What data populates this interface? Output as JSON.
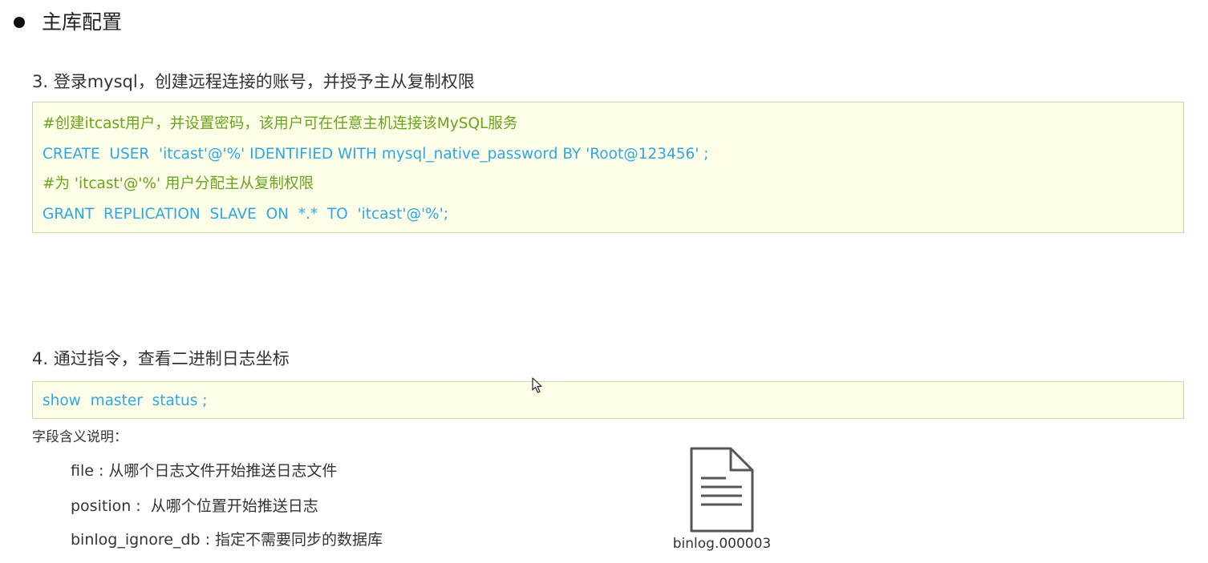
{
  "heading": {
    "bullet_icon": "bullet-dot-icon",
    "title": "主库配置"
  },
  "step3": {
    "heading": "3. 登录mysql，创建远程连接的账号，并授予主从复制权限",
    "code_lines": [
      {
        "type": "comment",
        "text": "#创建itcast用户，并设置密码，该用户可在任意主机连接该MySQL服务"
      },
      {
        "type": "sql",
        "text": "CREATE  USER  'itcast'@'%' IDENTIFIED WITH mysql_native_password BY 'Root@123456' ;"
      },
      {
        "type": "comment",
        "text": "#为 'itcast'@'%' 用户分配主从复制权限"
      },
      {
        "type": "sql",
        "text": "GRANT  REPLICATION  SLAVE  ON  *.*  TO  'itcast'@'%';"
      }
    ]
  },
  "step4": {
    "heading": "4. 通过指令，查看二进制日志坐标",
    "code_lines": [
      {
        "type": "sql",
        "text": "show  master  status ;"
      }
    ]
  },
  "fields": {
    "label": "字段含义说明：",
    "items": [
      "file : 从哪个日志文件开始推送日志文件",
      "position :  从哪个位置开始推送日志",
      "binlog_ignore_db : 指定不需要同步的数据库"
    ]
  },
  "file_illustration": {
    "icon": "document-file-icon",
    "caption": "binlog.000003"
  },
  "colors": {
    "code_background": "#fefde8",
    "code_border": "#d6d2ac",
    "comment": "#67a51c",
    "sql": "#2da8e4"
  },
  "cursor": {
    "icon": "mouse-pointer-icon"
  }
}
